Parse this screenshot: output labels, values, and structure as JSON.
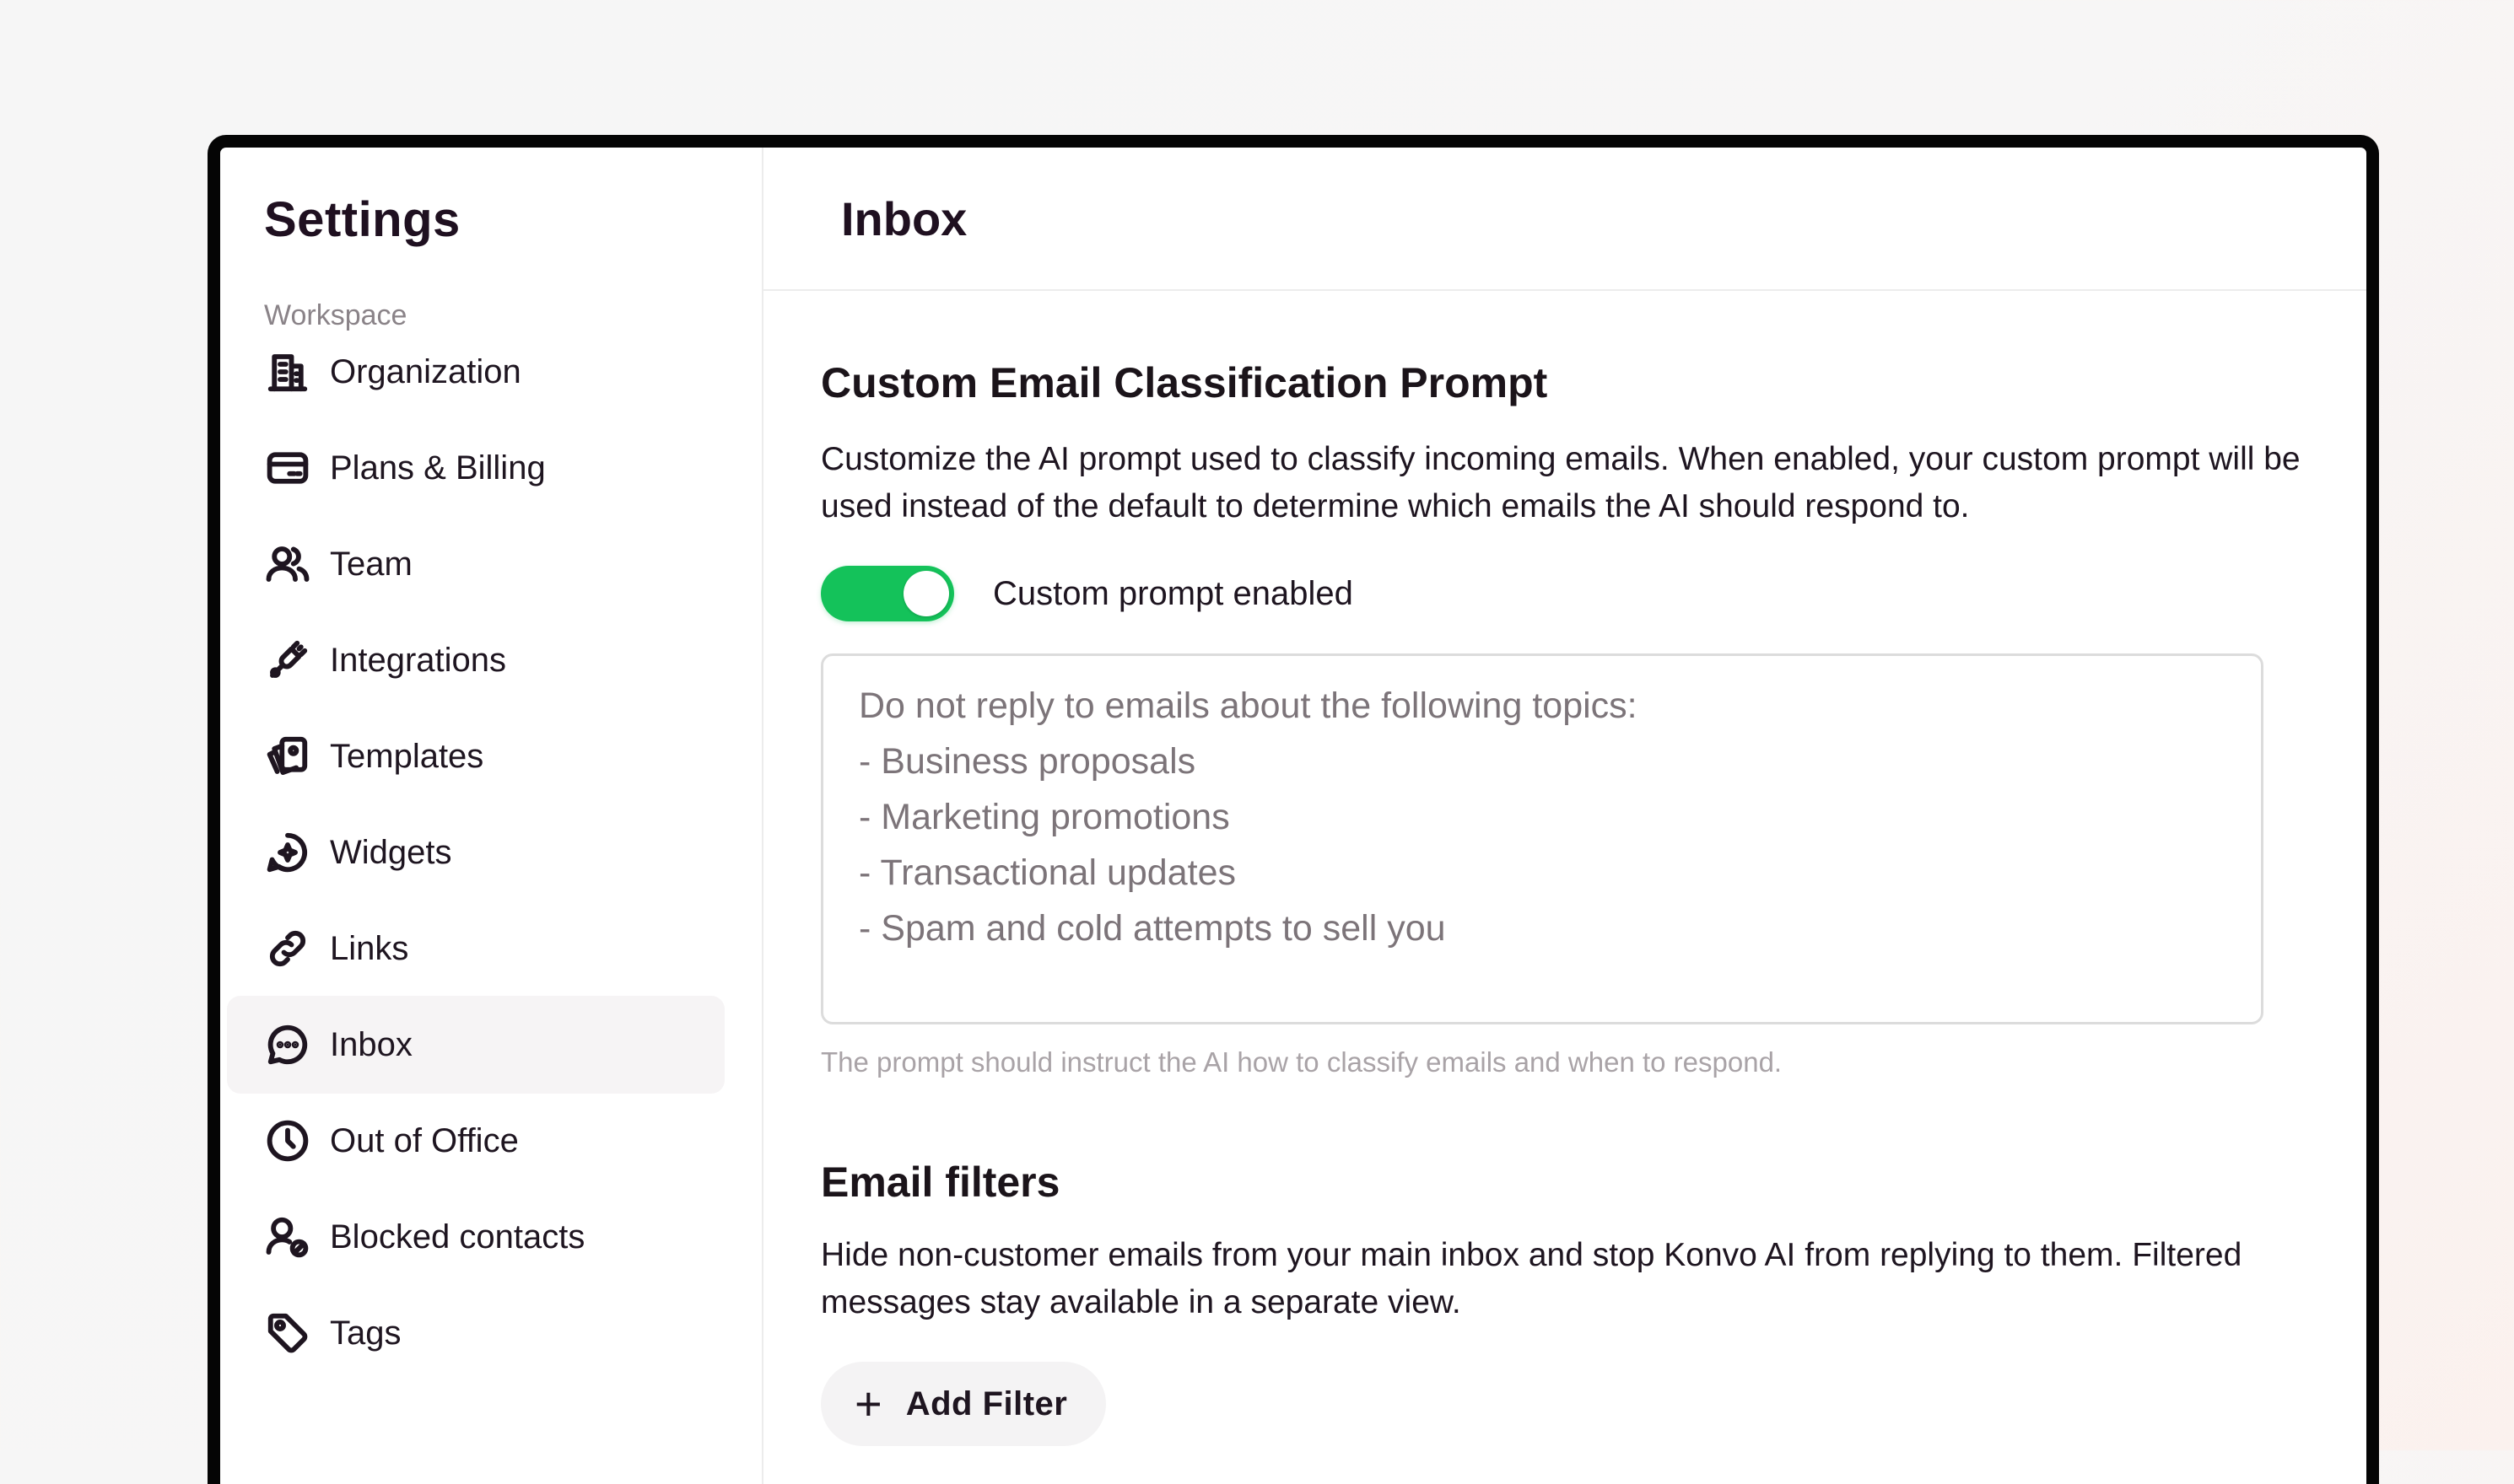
{
  "sidebar": {
    "title": "Settings",
    "section_label": "Workspace",
    "items": [
      {
        "label": "Organization",
        "icon": "building-icon"
      },
      {
        "label": "Plans & Billing",
        "icon": "credit-card-icon"
      },
      {
        "label": "Team",
        "icon": "users-icon"
      },
      {
        "label": "Integrations",
        "icon": "plug-icon"
      },
      {
        "label": "Templates",
        "icon": "templates-icon"
      },
      {
        "label": "Widgets",
        "icon": "widget-icon"
      },
      {
        "label": "Links",
        "icon": "link-icon"
      },
      {
        "label": "Inbox",
        "icon": "chat-bubble-icon",
        "active": true
      },
      {
        "label": "Out of Office",
        "icon": "clock-icon"
      },
      {
        "label": "Blocked contacts",
        "icon": "blocked-user-icon"
      },
      {
        "label": "Tags",
        "icon": "tag-icon"
      }
    ]
  },
  "main": {
    "title": "Inbox",
    "classification": {
      "heading": "Custom Email Classification Prompt",
      "description": "Customize the AI prompt used to classify incoming emails. When enabled, your custom prompt will be used instead of the default to determine which emails the AI should respond to.",
      "toggle_label": "Custom prompt enabled",
      "toggle_on": true,
      "prompt_lines": [
        "Do not reply to emails about the following topics:",
        "- Business proposals",
        "- Marketing promotions",
        "- Transactional updates",
        "- Spam and cold attempts to sell you"
      ],
      "hint": "The prompt should instruct the AI how to classify emails and when to respond."
    },
    "filters": {
      "heading": "Email filters",
      "description": "Hide non-customer emails from your main inbox and stop Konvo AI from replying to them. Filtered messages stay available in a separate view.",
      "add_button_label": "Add Filter"
    }
  },
  "colors": {
    "toggle_on": "#14c25a",
    "active_item_bg": "#f6f4f5",
    "text_primary": "#1e1520"
  }
}
